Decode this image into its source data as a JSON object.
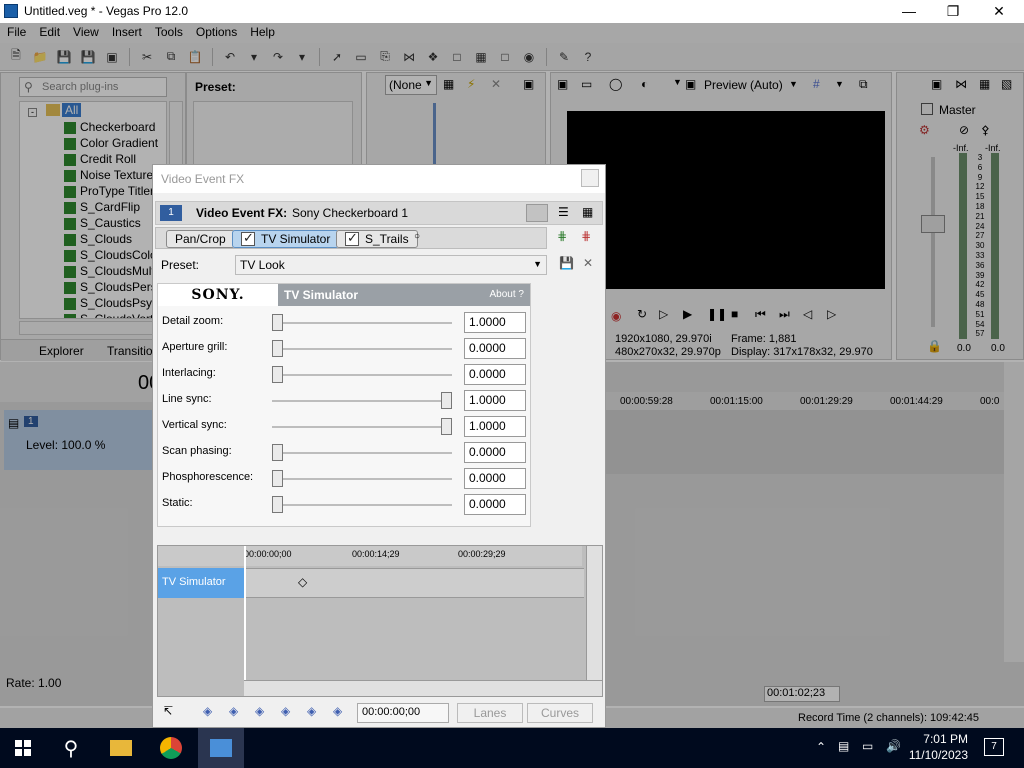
{
  "window": {
    "title": "Untitled.veg * - Vegas Pro 12.0"
  },
  "menu": [
    "File",
    "Edit",
    "View",
    "Insert",
    "Tools",
    "Options",
    "Help"
  ],
  "plugins": {
    "search_placeholder": "Search plug-ins",
    "root": "All",
    "items": [
      "Checkerboard",
      "Color Gradient",
      "Credit Roll",
      "Noise Texture",
      "ProType Titler",
      "S_CardFlip",
      "S_Caustics",
      "S_Clouds",
      "S_CloudsColor",
      "S_CloudsMultC",
      "S_CloudsPersp",
      "S_CloudsPsyk",
      "S_CloudsVorte"
    ],
    "tabs": [
      "Explorer",
      "Transition"
    ]
  },
  "preset_pane": {
    "label": "Preset:"
  },
  "track_pane": {
    "dropdown": "(None"
  },
  "preview": {
    "quality": "Preview (Auto)",
    "project_info": "1920x1080, 29.970i",
    "preview_info": "480x270x32, 29.970p",
    "frame_label": "Frame:",
    "frame_value": "1,881",
    "display_label": "Display:",
    "display_value": "317x178x32, 29.970"
  },
  "master": {
    "label": "Master",
    "inf_left": "-Inf.",
    "inf_right": "-Inf.",
    "scale": [
      "3",
      "6",
      "9",
      "12",
      "15",
      "18",
      "21",
      "24",
      "27",
      "30",
      "33",
      "36",
      "39",
      "42",
      "45",
      "48",
      "51",
      "54",
      "57"
    ],
    "val_left": "0.0",
    "val_right": "0.0"
  },
  "timeline": {
    "ruler": [
      "00:00:59:28",
      "00:01:15:00",
      "00:01:29:29",
      "00:01:44:29",
      "00:0"
    ],
    "level": "Level: 100.0 %",
    "rate": "Rate: 1.00",
    "timecode": "00:01:02;23",
    "track_num": "1",
    "big_time": "00"
  },
  "status": {
    "record_time": "Record Time (2 channels): 109:42:45"
  },
  "dialog": {
    "title": "Video Event FX",
    "header_num": "1",
    "header_label": "Video Event FX:",
    "header_value": "Sony Checkerboard 1",
    "chain": [
      "Pan/Crop",
      "TV Simulator",
      "S_Trails"
    ],
    "preset_label": "Preset:",
    "preset_value": "TV Look",
    "brand": "SONY.",
    "plugin_name": "TV Simulator",
    "about": "About  ?",
    "params": [
      {
        "label": "Detail zoom:",
        "value": "1.0000",
        "level": 0.0
      },
      {
        "label": "Aperture grill:",
        "value": "0.0000",
        "level": 0.0
      },
      {
        "label": "Interlacing:",
        "value": "0.0000",
        "level": 0.0
      },
      {
        "label": "Line sync:",
        "value": "1.0000",
        "level": 1.0
      },
      {
        "label": "Vertical sync:",
        "value": "1.0000",
        "level": 1.0
      },
      {
        "label": "Scan phasing:",
        "value": "0.0000",
        "level": 0.0
      },
      {
        "label": "Phosphorescence:",
        "value": "0.0000",
        "level": 0.0
      },
      {
        "label": "Static:",
        "value": "0.0000",
        "level": 0.0
      }
    ],
    "kf_ruler": [
      "00:00:00;00",
      "00:00:14;29",
      "00:00:29;29"
    ],
    "kf_track": "TV Simulator",
    "kf_time": "00:00:00;00",
    "lanes": "Lanes",
    "curves": "Curves"
  },
  "taskbar": {
    "time": "7:01 PM",
    "date": "11/10/2023",
    "notifications": "7"
  }
}
